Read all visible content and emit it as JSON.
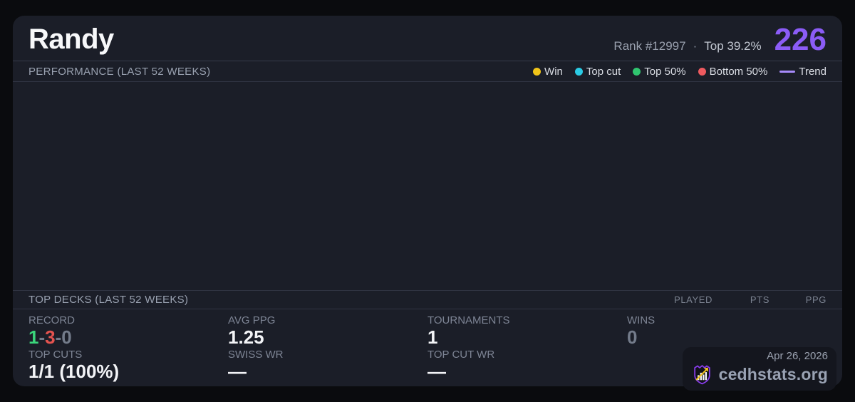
{
  "colors": {
    "page_bg": "#0a0b0e",
    "card_bg": "#1b1e28",
    "accent_purple": "#8b5cf6",
    "trend_purple": "#a78bfa",
    "win_yellow": "#f0c419",
    "top_cut_cyan": "#2bcbe4",
    "top50_green": "#30c56f",
    "bottom50_red": "#ee5a5f",
    "record_win_green": "#3bd57b",
    "record_loss_red": "#e4534f",
    "record_draw_gray": "#737b8a",
    "brand_shield_purple": "#8b3df0",
    "brand_arrow_yellow": "#f2c31d"
  },
  "header": {
    "player_name": "Randy",
    "rank_label": "Rank #12997",
    "separator": "·",
    "top_percent": "Top 39.2%",
    "score": "226"
  },
  "performance": {
    "section_title": "PERFORMANCE (LAST 52 WEEKS)",
    "legend": [
      {
        "label": "Win",
        "color": "#f0c419"
      },
      {
        "label": "Top cut",
        "color": "#2bcbe4"
      },
      {
        "label": "Top 50%",
        "color": "#30c56f"
      },
      {
        "label": "Bottom 50%",
        "color": "#ee5a5f"
      },
      {
        "label": "Trend",
        "color": "#a78bfa"
      }
    ]
  },
  "chart_data": {
    "type": "scatter",
    "title": "PERFORMANCE (LAST 52 WEEKS)",
    "xlabel": "",
    "ylabel": "",
    "grid": false,
    "legend_position": "top-right",
    "x": [],
    "series": [
      {
        "name": "Win",
        "values": []
      },
      {
        "name": "Top cut",
        "values": []
      },
      {
        "name": "Top 50%",
        "values": []
      },
      {
        "name": "Bottom 50%",
        "values": []
      },
      {
        "name": "Trend",
        "values": []
      }
    ]
  },
  "top_decks": {
    "section_title": "TOP DECKS (LAST 52 WEEKS)",
    "columns": [
      "PLAYED",
      "PTS",
      "PPG"
    ],
    "rows": []
  },
  "stats": {
    "record": {
      "label": "RECORD",
      "wins": "1",
      "losses": "3",
      "draws": "0",
      "separator": "-"
    },
    "avg_ppg": {
      "label": "AVG PPG",
      "value": "1.25"
    },
    "tournaments": {
      "label": "TOURNAMENTS",
      "value": "1"
    },
    "wins": {
      "label": "WINS",
      "value": "0"
    },
    "top_cuts": {
      "label": "TOP CUTS",
      "value": "1/1 (100%)"
    },
    "swiss_wr": {
      "label": "SWISS WR",
      "value": "—"
    },
    "top_cut_wr": {
      "label": "TOP CUT WR",
      "value": "—"
    }
  },
  "footer": {
    "date": "Apr 26, 2026",
    "site_name": "cedhstats.org"
  }
}
